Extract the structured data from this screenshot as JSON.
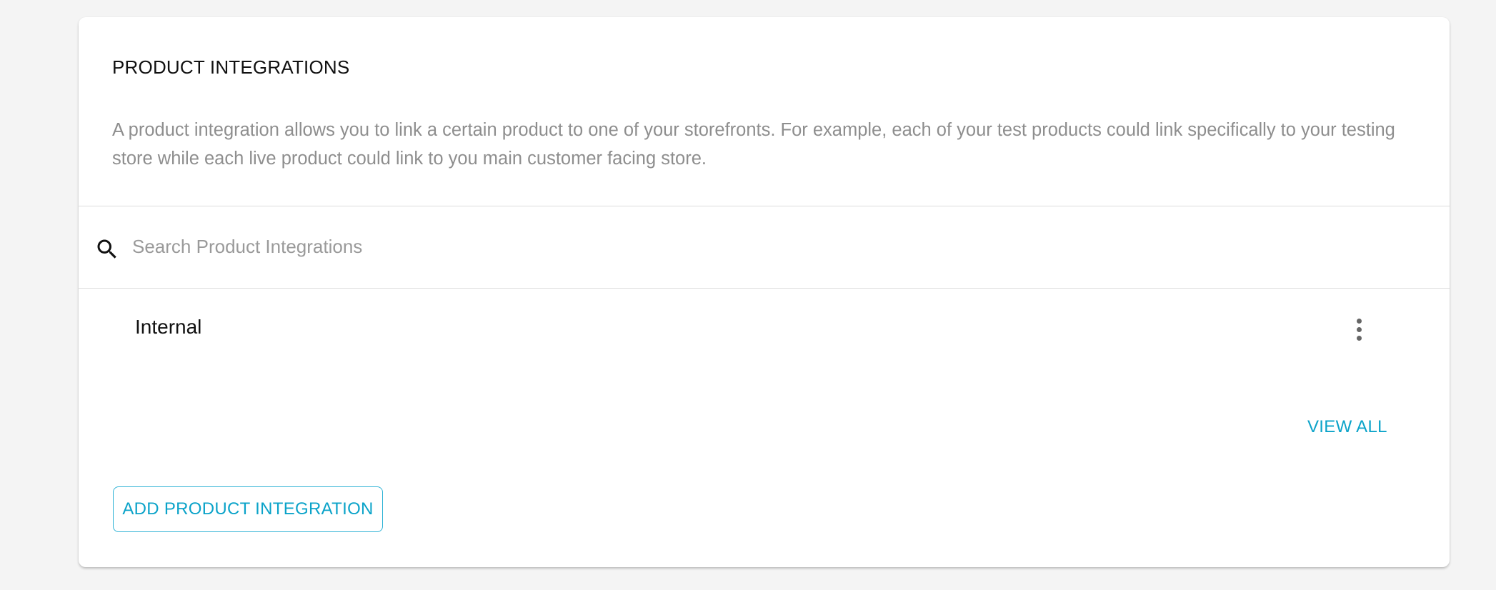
{
  "card": {
    "title": "PRODUCT INTEGRATIONS",
    "description": "A product integration allows you to link a certain product to one of your storefronts. For example, each of your test products could link specifically to your testing store while each live product could link to you main customer facing store."
  },
  "search": {
    "icon": "search-icon",
    "placeholder": "Search Product Integrations",
    "value": ""
  },
  "integrations": [
    {
      "label": "Internal",
      "menu_icon": "more-vertical-icon"
    }
  ],
  "actions": {
    "view_all_label": "VIEW ALL",
    "add_label": "ADD PRODUCT INTEGRATION"
  },
  "colors": {
    "accent": "#0ba3c9",
    "accent_border": "#2fb3d6",
    "background": "#f4f4f4",
    "card_background": "#ffffff",
    "muted_text": "#8e8e8e",
    "divider": "#dcdcdc"
  }
}
